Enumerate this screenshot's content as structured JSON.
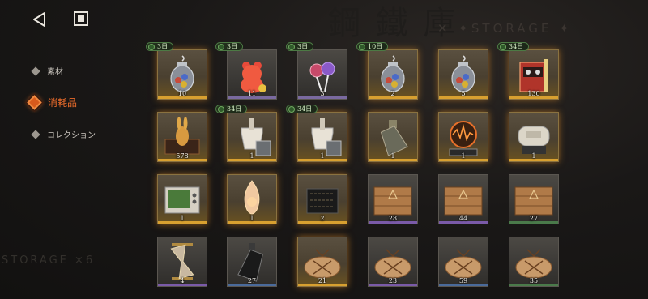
{
  "header": {
    "watermark_storage": "✕ ✦STORAGE ✦",
    "watermark_storage_bottom": "STORAGE ×6"
  },
  "nav": {
    "back": "back",
    "stop": "stop"
  },
  "categories": [
    {
      "label": "素材",
      "active": false
    },
    {
      "label": "消耗品",
      "active": true
    },
    {
      "label": "コレクション",
      "active": false
    }
  ],
  "items": [
    {
      "name": "candy-jar",
      "count": "10",
      "timer": "3日",
      "rarity": "gold",
      "bar": "#d8a030"
    },
    {
      "name": "gummy-bear",
      "count": "11",
      "timer": "3日",
      "rarity": "gray",
      "bar": "#7a6aa0"
    },
    {
      "name": "lollipops",
      "count": "3",
      "timer": "3日",
      "rarity": "gray",
      "bar": "#7a6aa0"
    },
    {
      "name": "candy-jar",
      "count": "2",
      "timer": "10日",
      "rarity": "gold",
      "bar": "#d8a030"
    },
    {
      "name": "candy-jar",
      "count": "5",
      "timer": "",
      "rarity": "gold",
      "bar": "#d8a030"
    },
    {
      "name": "cassette-box",
      "count": "130",
      "timer": "34日",
      "rarity": "gold",
      "bar": "#d8a030"
    },
    {
      "name": "golden-rabbit-box",
      "count": "578",
      "timer": "",
      "rarity": "gold",
      "bar": "#d8a030"
    },
    {
      "name": "mortar-set",
      "count": "1",
      "timer": "34日",
      "rarity": "gold",
      "bar": "#d8a030"
    },
    {
      "name": "mortar-set",
      "count": "1",
      "timer": "34日",
      "rarity": "gold",
      "bar": "#d8a030"
    },
    {
      "name": "bottle",
      "count": "1",
      "timer": "",
      "rarity": "gold",
      "bar": "#d8a030"
    },
    {
      "name": "signal-device",
      "count": "1",
      "timer": "",
      "rarity": "gold",
      "bar": "#d8a030"
    },
    {
      "name": "canister",
      "count": "1",
      "timer": "",
      "rarity": "gold",
      "bar": "#d8a030"
    },
    {
      "name": "old-tv",
      "count": "1",
      "timer": "",
      "rarity": "gold",
      "bar": "#d8a030"
    },
    {
      "name": "flame-shard",
      "count": "1",
      "timer": "",
      "rarity": "gold",
      "bar": "#d8a030"
    },
    {
      "name": "runic-box",
      "count": "2",
      "timer": "",
      "rarity": "gold",
      "bar": "#d8a030"
    },
    {
      "name": "wooden-crate",
      "count": "28",
      "timer": "",
      "rarity": "purple",
      "bar": "#7a5aa8"
    },
    {
      "name": "wooden-crate",
      "count": "44",
      "timer": "",
      "rarity": "purple",
      "bar": "#7a5aa8"
    },
    {
      "name": "wooden-crate",
      "count": "27",
      "timer": "",
      "rarity": "green",
      "bar": "#4a7a4a"
    },
    {
      "name": "hourglass",
      "count": "4",
      "timer": "",
      "rarity": "purple",
      "bar": "#7a5aa8"
    },
    {
      "name": "black-bottle",
      "count": "27",
      "timer": "",
      "rarity": "blue",
      "bar": "#4a6a9a"
    },
    {
      "name": "cloth-bundle",
      "count": "21",
      "timer": "",
      "rarity": "gold",
      "bar": "#d8a030"
    },
    {
      "name": "cloth-bundle",
      "count": "23",
      "timer": "",
      "rarity": "purple",
      "bar": "#7a5aa8"
    },
    {
      "name": "cloth-bundle",
      "count": "59",
      "timer": "",
      "rarity": "blue",
      "bar": "#4a6a9a"
    },
    {
      "name": "cloth-bundle",
      "count": "35",
      "timer": "",
      "rarity": "green",
      "bar": "#4a7a4a"
    }
  ]
}
